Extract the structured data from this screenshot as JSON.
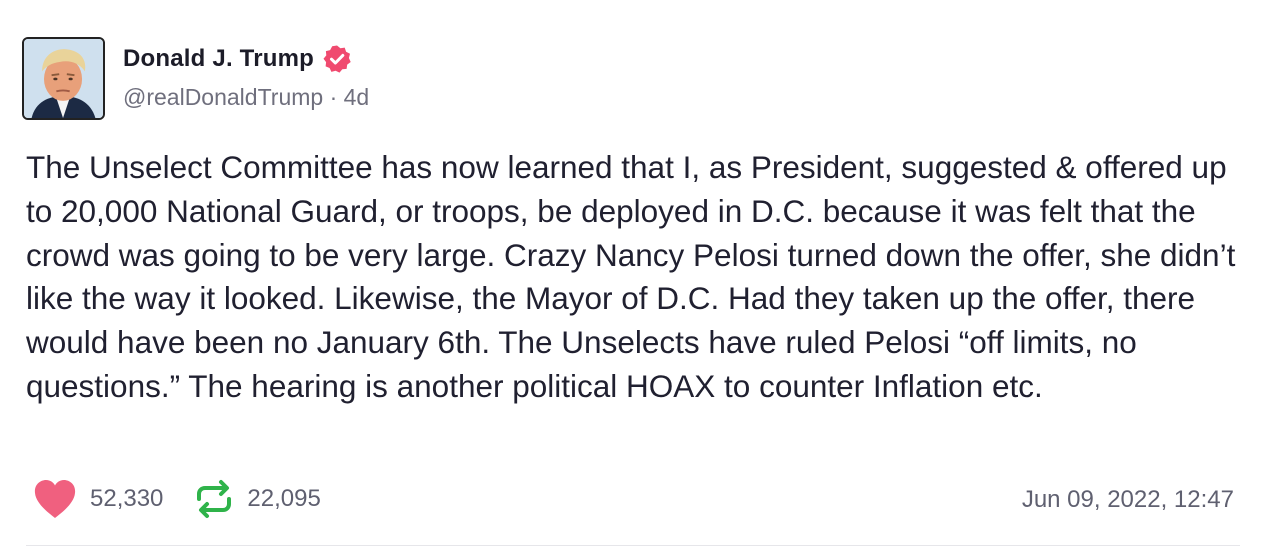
{
  "author": {
    "display_name": "Donald J. Trump",
    "handle": "@realDonaldTrump",
    "separator": "·",
    "relative_time": "4d",
    "verified": true,
    "avatar_icon": "profile-photo"
  },
  "post": {
    "text": "The Unselect Committee has now learned that I, as President, suggested & offered up to 20,000 National Guard, or troops, be deployed in D.C. because it was felt that the crowd was going to be very large. Crazy Nancy Pelosi turned down the offer, she didn’t like the way it looked. Likewise, the Mayor of D.C. Had they taken up the offer, there would have been no January 6th. The Unselects have ruled Pelosi “off limits, no questions.” The hearing is another political HOAX to counter Inflation etc."
  },
  "actions": {
    "likes": "52,330",
    "reposts": "22,095",
    "like_icon": "heart-icon",
    "repost_icon": "repost-icon"
  },
  "timestamp": "Jun 09, 2022, 12:47",
  "colors": {
    "heart": "#f0607f",
    "repost": "#2fb34a",
    "verified_badge": "#f04a6f",
    "muted_text": "#6f6f7d"
  }
}
